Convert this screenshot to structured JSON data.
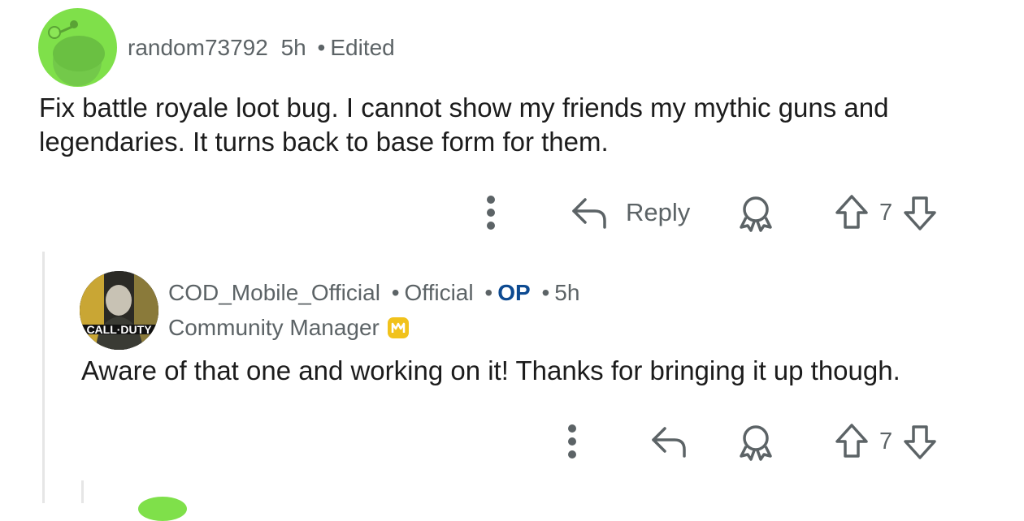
{
  "comment": {
    "username": "random73792",
    "time": "5h",
    "edited": "Edited",
    "body": "Fix battle royale loot bug. I cannot show my friends my mythic guns and legendaries. It turns back to base form for them.",
    "reply_label": "Reply",
    "vote_count": "7",
    "avatar_color": "#7fe04a"
  },
  "reply": {
    "username": "COD_Mobile_Official",
    "official": "Official",
    "op": "OP",
    "time": "5h",
    "flair": "Community Manager",
    "body": "Aware of that one and working on it! Thanks for bringing it up though.",
    "vote_count": "7",
    "avatar_logo_text": "CALL·DUTY",
    "op_color": "#0d4a91"
  },
  "icons": {
    "more": "more-vertical-icon",
    "reply": "reply-arrow-icon",
    "award": "award-icon",
    "upvote": "upvote-icon",
    "downvote": "downvote-icon",
    "badge": "codm-badge-icon"
  }
}
